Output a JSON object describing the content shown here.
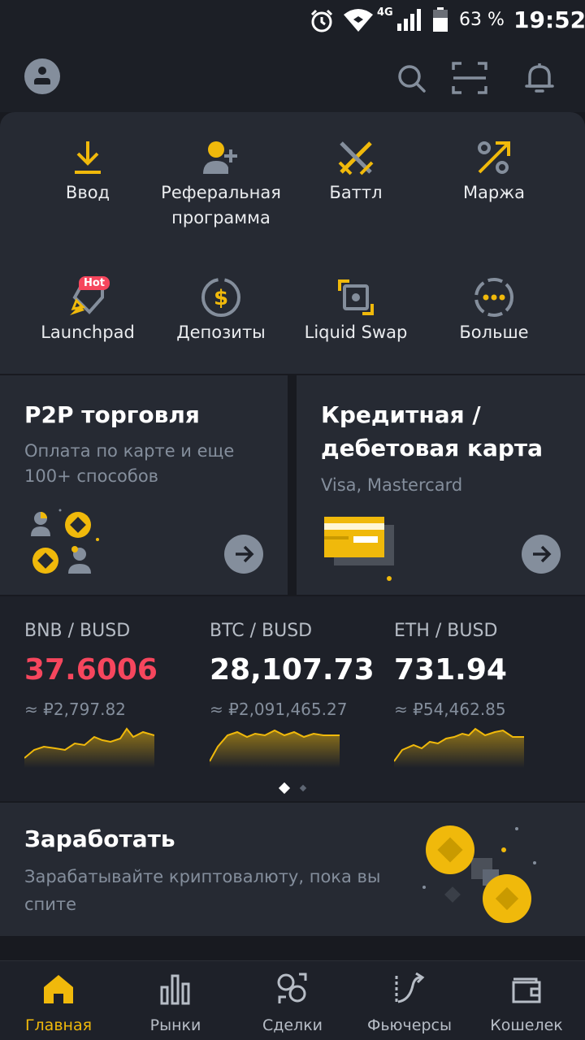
{
  "status": {
    "battery": "63 %",
    "network": "4G",
    "time": "19:52"
  },
  "quick_actions": [
    {
      "label": "Ввод",
      "icon": "deposit-icon"
    },
    {
      "label": "Реферальная программа",
      "icon": "referral-icon"
    },
    {
      "label": "Баттл",
      "icon": "battle-icon"
    },
    {
      "label": "Маржа",
      "icon": "margin-icon"
    },
    {
      "label": "Launchpad",
      "icon": "launchpad-icon",
      "badge": "Hot"
    },
    {
      "label": "Депозиты",
      "icon": "deposits-icon"
    },
    {
      "label": "Liquid Swap",
      "icon": "liquid-swap-icon"
    },
    {
      "label": "Больше",
      "icon": "more-icon"
    }
  ],
  "cards": {
    "p2p": {
      "title": "P2P торговля",
      "subtitle": "Оплата по карте и еще 100+ способов"
    },
    "credit": {
      "title": "Кредитная / дебетовая карта",
      "subtitle": "Visa, Mastercard"
    }
  },
  "tickers": [
    {
      "pair": "BNB / BUSD",
      "price": "37.6006",
      "fiat": "≈ ₽2,797.82",
      "color": "#f6465d"
    },
    {
      "pair": "BTC / BUSD",
      "price": "28,107.73",
      "fiat": "≈ ₽2,091,465.27",
      "color": "#ffffff"
    },
    {
      "pair": "ETH / BUSD",
      "price": "731.94",
      "fiat": "≈ ₽54,462.85",
      "color": "#ffffff"
    }
  ],
  "earn": {
    "title": "Заработать",
    "subtitle": "Зарабатывайте криптовалюту, пока вы спите"
  },
  "nav": [
    {
      "label": "Главная",
      "active": true
    },
    {
      "label": "Рынки"
    },
    {
      "label": "Сделки"
    },
    {
      "label": "Фьючерсы"
    },
    {
      "label": "Кошелек"
    }
  ],
  "colors": {
    "accent": "#f0b90b",
    "down": "#f6465d",
    "bg": "#181a20",
    "card": "#262a33"
  }
}
